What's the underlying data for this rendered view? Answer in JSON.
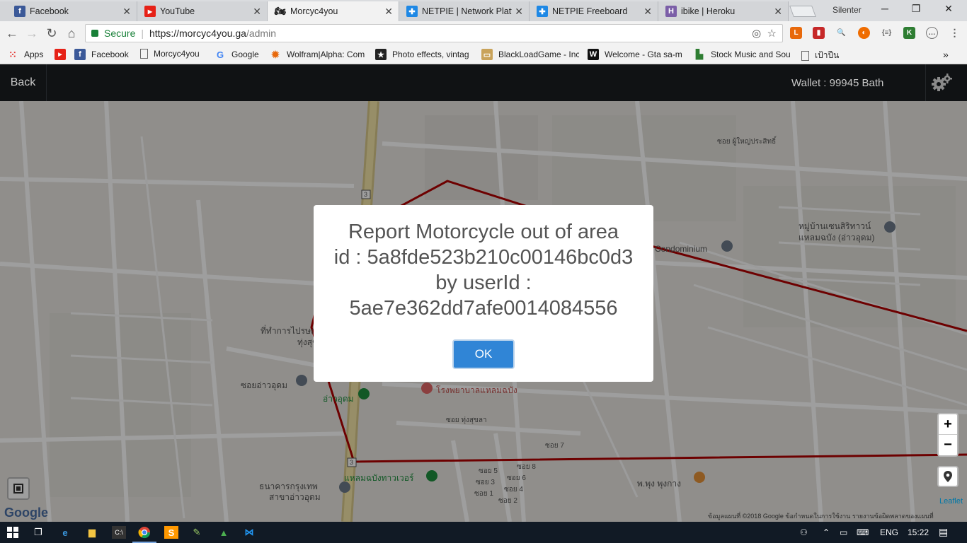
{
  "browser": {
    "tabs": [
      {
        "title": "Facebook",
        "icon": "facebook-icon",
        "color": "#3b5998",
        "glyph": "f"
      },
      {
        "title": "YouTube",
        "icon": "youtube-icon",
        "color": "#e62117",
        "glyph": "▶"
      },
      {
        "title": "Morcyc4you",
        "icon": "motorcycle-icon",
        "color": "#333333",
        "glyph": "⚲"
      },
      {
        "title": "NETPIE | Network Platfo",
        "icon": "netpie-icon",
        "color": "#1e88e5",
        "glyph": "✚"
      },
      {
        "title": "NETPIE Freeboard",
        "icon": "netpie-icon",
        "color": "#1e88e5",
        "glyph": "✚"
      },
      {
        "title": "ibike | Heroku",
        "icon": "heroku-icon",
        "color": "#7b5ea7",
        "glyph": "H"
      }
    ],
    "profile_name": "Silenter",
    "address": {
      "secure_label": "Secure",
      "url_host": "https://morcyc4you.ga",
      "url_path": "/admin"
    },
    "bookmarks": [
      {
        "label": "Apps",
        "icon": "apps-grid-icon",
        "color": "#e53935",
        "glyph": "⋮"
      },
      {
        "label": "",
        "icon": "youtube-icon",
        "color": "#e62117",
        "glyph": "▶"
      },
      {
        "label": "Facebook",
        "icon": "facebook-icon",
        "color": "#3b5998",
        "glyph": "f"
      },
      {
        "label": "Morcyc4you",
        "icon": "page-icon",
        "color": "#ffffff",
        "glyph": ""
      },
      {
        "label": "Google",
        "icon": "google-icon",
        "color": "#ffffff",
        "glyph": "G"
      },
      {
        "label": "Wolfram|Alpha: Com",
        "icon": "wolfram-icon",
        "color": "#e8690b",
        "glyph": "✹"
      },
      {
        "label": "Photo effects, vintag",
        "icon": "photo-effects-icon",
        "color": "#222222",
        "glyph": "★"
      },
      {
        "label": "BlackLoadGame - Inc",
        "icon": "blackload-icon",
        "color": "#c9a35a",
        "glyph": "▭"
      },
      {
        "label": "Welcome - Gta sa-m",
        "icon": "wordpress-icon",
        "color": "#111111",
        "glyph": "W"
      },
      {
        "label": "Stock Music and Sou",
        "icon": "stock-music-icon",
        "color": "#2e7d32",
        "glyph": "▮"
      },
      {
        "label": "เป้าปืน",
        "icon": "page-icon",
        "color": "#ffffff",
        "glyph": ""
      }
    ]
  },
  "app": {
    "back_label": "Back",
    "wallet_label": "Wallet : 99945 Bath"
  },
  "map": {
    "labels": {
      "condominium": "Condominium",
      "village": "หมู่บ้านเซนสิริทาวน์",
      "village2": "แหลมฉบัง (อ่าวอุดม)",
      "soi_phuyai": "ซอย ผู้ใหญ่ประสิทธิ์",
      "post_office": "ที่ทำการไปรษณีย์",
      "post_office2": "ทุ่งสุขลา",
      "soi_ao_udom": "ซอยอ่าวอุดม",
      "ao_udom": "อ่าวอุดม",
      "hospital": "โรงพยาบาลแหลมฉบัง",
      "soi_tungsukla": "ซอย ทุ่งสุขลา",
      "tower": "แหลมฉบังทาวเวอร์",
      "bank": "ธนาคารกรุงเทพ",
      "bank2": "สาขาอ่าวอุดม",
      "phung": "พ.พุง พุงกาง",
      "soi_7": "ซอย 7",
      "soi_8": "ซอย 8",
      "soi_5": "ซอย 5",
      "soi_6": "ซอย 6",
      "soi_3": "ซอย 3",
      "soi_4": "ซอย 4",
      "soi_1": "ซอย 1",
      "soi_2": "ซอย 2",
      "route3a": "3",
      "route3b": "3"
    },
    "zoom_in": "+",
    "zoom_out": "−",
    "google_logo": "Google",
    "leaflet_label": "Leaflet",
    "attribution": "ข้อมูลแผนที่ ©2018 Google   ข้อกำหนดในการใช้งาน   รายงานข้อผิดพลาดของแผนที่",
    "boundary_color": "#b00000"
  },
  "modal": {
    "message": "Report Motorcycle out of area\nid : 5a8fde523b210c00146bc0d3\nby userId :\n5ae7e362dd7afe0014084556",
    "ok_label": "OK"
  },
  "taskbar": {
    "language": "ENG",
    "time": "15:22"
  }
}
